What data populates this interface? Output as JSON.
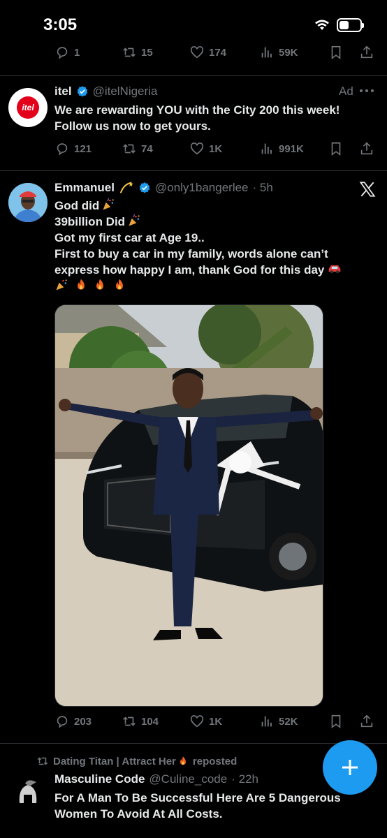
{
  "status_bar": {
    "time": "3:05",
    "battery_level": 0.45
  },
  "tweet_top": {
    "actions": {
      "replies": "1",
      "reposts": "15",
      "likes": "174",
      "views": "59K"
    }
  },
  "ad_tweet": {
    "name": "itel",
    "handle": "@itelNigeria",
    "ad_label": "Ad",
    "avatar_text": "itel",
    "text_lines": [
      "We are rewarding YOU with the City 200 this week!",
      "Follow us now to get yours."
    ],
    "actions": {
      "replies": "121",
      "reposts": "74",
      "likes": "1K",
      "views": "991K"
    }
  },
  "main_tweet": {
    "name": "Emmanuel",
    "handle": "@only1bangerlee",
    "time": "· 5h",
    "text_lines": [
      "God did",
      "39billion Did",
      "Got my first car at Age 19..",
      "First to buy a car in my family, words alone can’t",
      "express how happy I am, thank God for this day"
    ],
    "actions": {
      "replies": "203",
      "reposts": "104",
      "likes": "1K",
      "views": "52K"
    }
  },
  "bottom_tweet": {
    "repost_label": "Dating Titan | Attract Her",
    "repost_suffix": "reposted",
    "name": "Masculine Code",
    "handle": "@Culine_code",
    "time": "· 22h",
    "text_lines": [
      "For A Man To Be Successful Here Are 5 Dangerous",
      "Women To Avoid At All Costs."
    ]
  },
  "colors": {
    "accent": "#1d9bf0",
    "muted": "#71767b",
    "itel_red": "#e3001b"
  }
}
